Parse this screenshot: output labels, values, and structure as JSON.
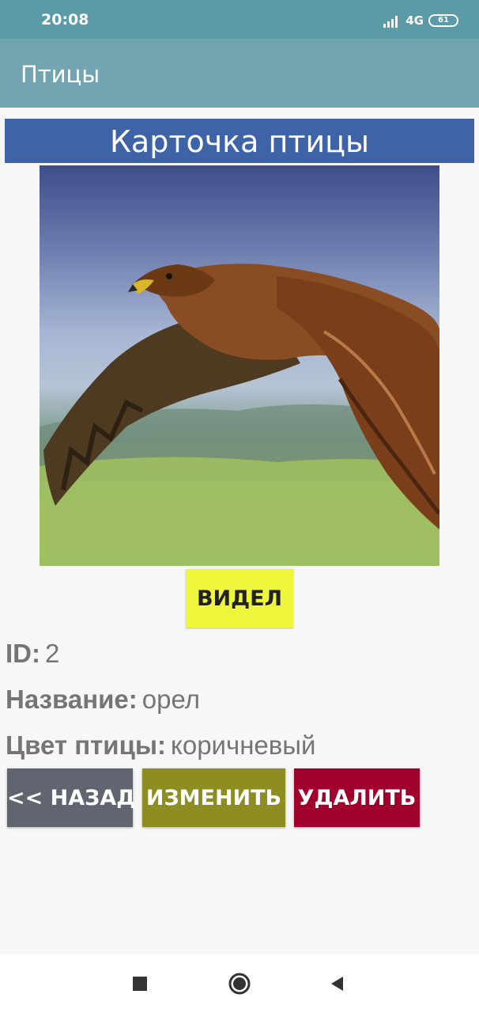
{
  "status_bar": {
    "time": "20:08",
    "network": "4G",
    "battery": "61"
  },
  "app_bar": {
    "title": "Птицы"
  },
  "card": {
    "header": "Карточка птицы",
    "photo_alt": "орел",
    "seen_button": "ВИДЕЛ",
    "fields": {
      "id_label": "ID:",
      "id_value": "2",
      "name_label": "Название:",
      "name_value": "орел",
      "color_label": "Цвет птицы:",
      "color_value": "коричневый"
    }
  },
  "actions": {
    "back": "<< НАЗАД",
    "edit": "ИЗМЕНИТЬ",
    "delete": "УДАЛИТЬ"
  },
  "nav": {
    "recent_icon": "square-icon",
    "home_icon": "circle-icon",
    "back_icon": "triangle-icon"
  },
  "colors": {
    "status_bar": "#5b9aa7",
    "app_bar": "#73a4b1",
    "card_header": "#3e63a6",
    "seen_button": "#eef73c",
    "back_button": "#60656f",
    "edit_button": "#8e8d21",
    "delete_button": "#a1002e"
  }
}
